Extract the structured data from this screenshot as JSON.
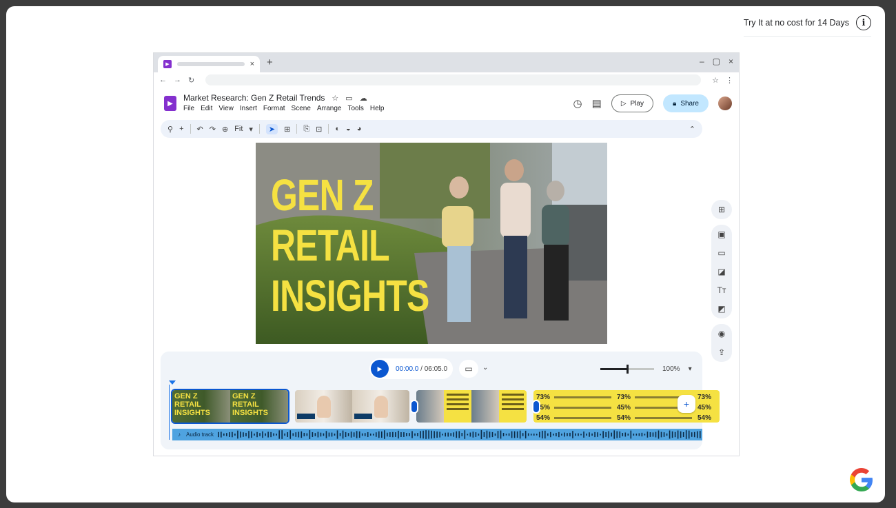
{
  "promo": {
    "text": "Try It at no cost for 14 Days",
    "info_icon": "info-icon"
  },
  "browser": {
    "new_tab": "+",
    "tab_close": "×",
    "window_controls": [
      "–",
      "▢",
      "×"
    ],
    "nav": [
      "←",
      "→",
      "↻"
    ],
    "address_icons": [
      "☆",
      "⋮"
    ]
  },
  "app": {
    "doc_title": "Market Research: Gen Z Retail Trends",
    "menu": [
      "File",
      "Edit",
      "View",
      "Insert",
      "Format",
      "Scene",
      "Arrange",
      "Tools",
      "Help"
    ],
    "play_label": "Play",
    "share_label": "Share",
    "zoom_fit": "Fit"
  },
  "slide": {
    "headline": [
      "GEN Z",
      "RETAIL",
      "INSIGHTS"
    ],
    "accent_color": "#f5e142"
  },
  "timeline": {
    "current_time": "00:00.0",
    "total_time": "06:05.0",
    "zoom": "100%",
    "zoom_level": 0.5,
    "audio_label": "Audio track",
    "clips": [
      {
        "thumbs": [
          [
            "GEN Z",
            "RETAIL",
            "INSIGHTS"
          ],
          [
            "GEN Z",
            "RETAIL",
            "INSIGHTS"
          ]
        ]
      },
      {
        "thumbs": 2
      },
      {
        "thumbs": 4
      },
      {
        "stats": [
          [
            "73%",
            "73%",
            "73%"
          ],
          [
            "45%",
            "45%",
            "45%"
          ],
          [
            "54%",
            "54%",
            "54%"
          ]
        ]
      }
    ]
  },
  "colors": {
    "accent_blue": "#0b57d0",
    "share_bg": "#c2e7ff",
    "brand_purple": "#8430ce"
  }
}
